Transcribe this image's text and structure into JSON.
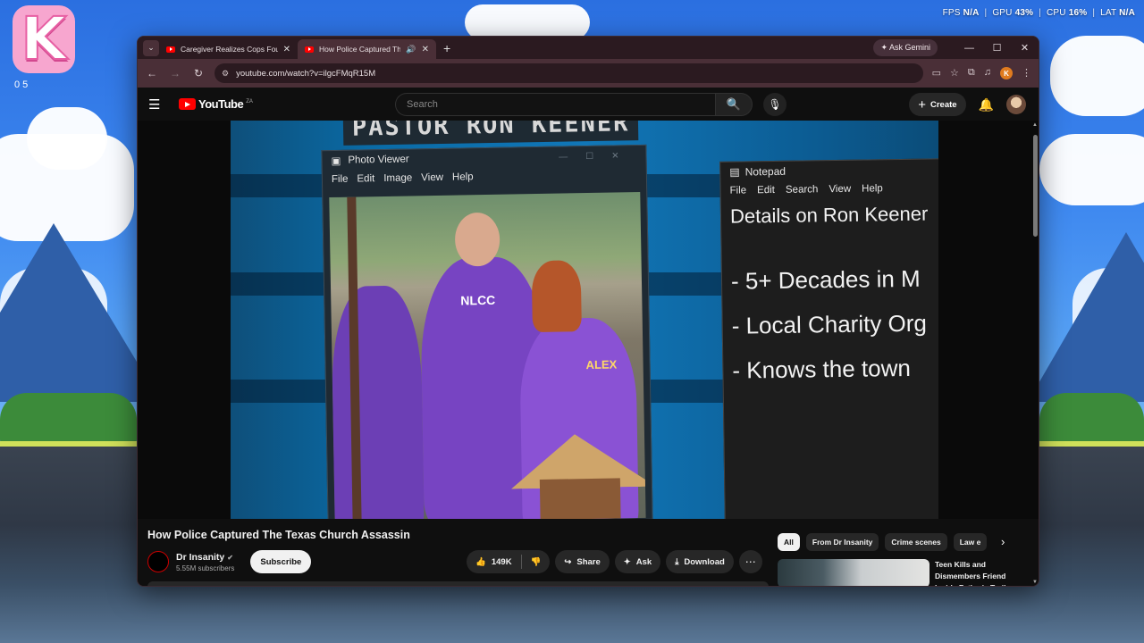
{
  "system_overlay": {
    "fps_label": "FPS",
    "fps_value": "N/A",
    "gpu_label": "GPU",
    "gpu_value": "43%",
    "cpu_label": "CPU",
    "cpu_value": "16%",
    "lat_label": "LAT",
    "lat_value": "N/A"
  },
  "desktop_app": {
    "logo_letter": "K",
    "counter": "0 5"
  },
  "browser": {
    "tabs": [
      {
        "title": "Caregiver Realizes Cops Found",
        "active": false
      },
      {
        "title": "How Police Captured The Te",
        "active": true
      }
    ],
    "ask_gemini": "Ask Gemini",
    "url": "youtube.com/watch?v=ilgcFMqR15M",
    "profile_initial": "K"
  },
  "youtube": {
    "logo_text": "YouTube",
    "region": "ZA",
    "search_placeholder": "Search",
    "create_label": "Create",
    "video": {
      "overlay_banner": "PASTOR RON KEENER",
      "photo_viewer": {
        "title": "Photo Viewer",
        "menu": [
          "File",
          "Edit",
          "Image",
          "View",
          "Help"
        ]
      },
      "notepad": {
        "title": "Notepad",
        "menu": [
          "File",
          "Edit",
          "Search",
          "View",
          "Help"
        ],
        "heading": "Details on Ron Keener",
        "lines": [
          "- 5+ Decades in M",
          "- Local Charity Org",
          "- Knows the town"
        ]
      },
      "shirt_text": "NLCC",
      "shirt_text2": "ALEX"
    },
    "title": "How Police Captured The Texas Church Assassin",
    "channel": {
      "name": "Dr Insanity",
      "subscribers": "5.55M subscribers",
      "avatar_text": "DR INSANITY"
    },
    "subscribe_label": "Subscribe",
    "actions": {
      "likes": "149K",
      "share": "Share",
      "ask": "Ask",
      "download": "Download"
    },
    "chips": [
      "All",
      "From Dr Insanity",
      "Crime scenes",
      "Law e"
    ],
    "recommendation": {
      "title": "Teen Kills and Dismembers Friend Inside Father's Trailer"
    }
  }
}
